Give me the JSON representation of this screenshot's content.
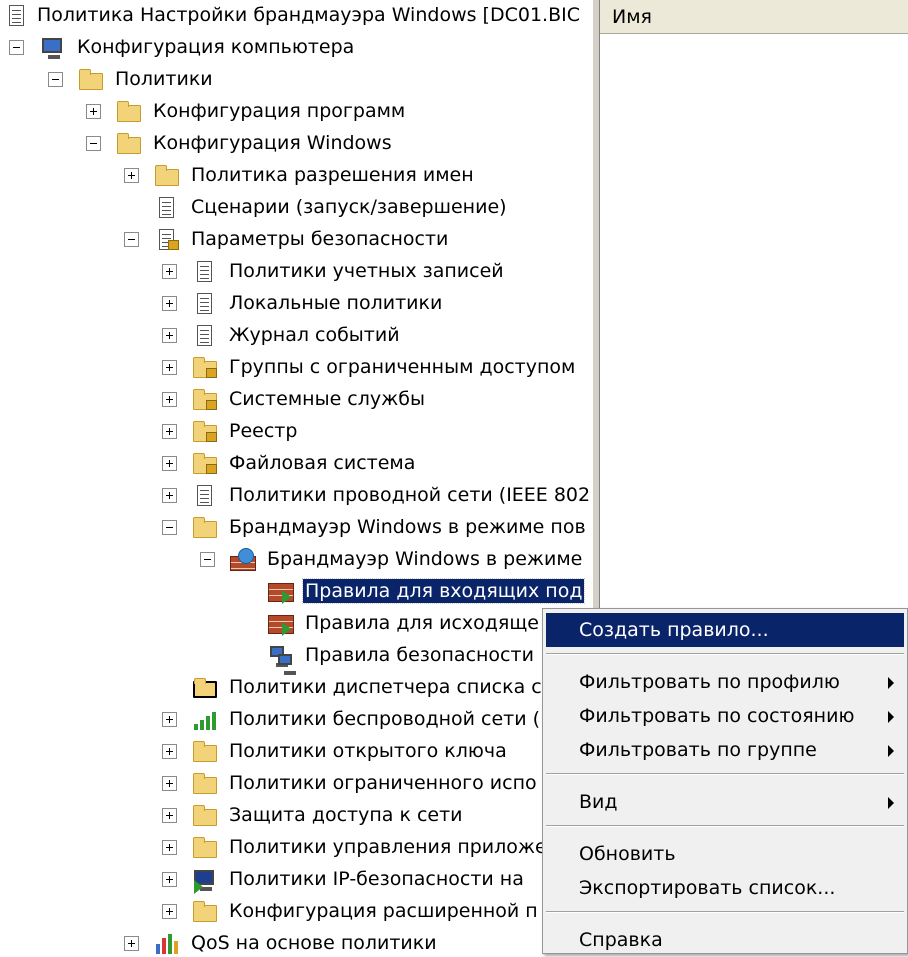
{
  "window": {
    "title": "Политика Настройки брандмауэра Windows [DC01.BIC"
  },
  "tree": {
    "computer_config": "Конфигурация компьютера",
    "policies": "Политики",
    "software_config": "Конфигурация программ",
    "windows_config": "Конфигурация Windows",
    "name_resolution": "Политика разрешения имен",
    "scripts": "Сценарии (запуск/завершение)",
    "security_settings": "Параметры безопасности",
    "account_policies": "Политики учетных записей",
    "local_policies": "Локальные политики",
    "event_log": "Журнал событий",
    "restricted_groups": "Группы с ограниченным доступом",
    "system_services": "Системные службы",
    "registry": "Реестр",
    "file_system": "Файловая система",
    "wired_network": "Политики проводной сети (IEEE 802",
    "firewall_advanced": "Брандмауэр Windows в режиме пов",
    "firewall_node": "Брандмауэр Windows в режиме",
    "inbound_rules": "Правила для входящих под",
    "outbound_rules": "Правила для исходяще",
    "security_rules": "Правила безопасности",
    "network_list": "Политики диспетчера списка с",
    "wireless_network": "Политики беспроводной сети (",
    "public_key": "Политики открытого ключа",
    "restricted_use": "Политики ограниченного испо",
    "nap": "Защита доступа к сети",
    "app_control": "Политики управления приложе",
    "ipsec": "Политики IP-безопасности на",
    "advanced_audit": "Конфигурация расширенной п",
    "qos": "QoS на основе политики"
  },
  "right_pane": {
    "column_name": "Имя"
  },
  "context_menu": {
    "create_rule": "Создать правило...",
    "filter_profile": "Фильтровать по профилю",
    "filter_state": "Фильтровать по состоянию",
    "filter_group": "Фильтровать по группе",
    "view": "Вид",
    "refresh": "Обновить",
    "export_list": "Экспортировать список...",
    "help": "Справка"
  },
  "colors": {
    "selection": "#0a246a",
    "folder": "#f3d37a"
  }
}
